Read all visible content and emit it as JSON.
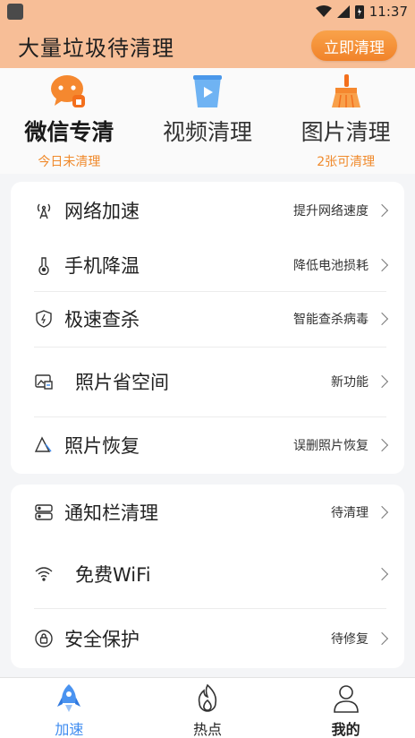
{
  "status_bar": {
    "time": "11:37"
  },
  "header": {
    "title": "大量垃圾待清理",
    "clean_button": "立即清理"
  },
  "quick_actions": [
    {
      "title": "微信专清",
      "subtitle": "今日未清理",
      "icon": "wechat-icon"
    },
    {
      "title": "视频清理",
      "subtitle": "",
      "icon": "video-icon"
    },
    {
      "title": "图片清理",
      "subtitle": "2张可清理",
      "icon": "broom-icon"
    }
  ],
  "group1": [
    {
      "title": "网络加速",
      "desc": "提升网络速度",
      "icon": "signal-tower-icon"
    },
    {
      "title": "手机降温",
      "desc": "降低电池损耗",
      "icon": "thermometer-icon"
    },
    {
      "title": "极速查杀",
      "desc": "智能查杀病毒",
      "icon": "shield-icon"
    },
    {
      "title": "照片省空间",
      "desc": "新功能",
      "icon": "photo-compress-icon"
    },
    {
      "title": "照片恢复",
      "desc": "误删照片恢复",
      "icon": "photo-restore-icon"
    }
  ],
  "group2": [
    {
      "title": "通知栏清理",
      "desc": "待清理",
      "icon": "notification-icon"
    },
    {
      "title": "免费WiFi",
      "desc": "",
      "icon": "wifi-icon"
    },
    {
      "title": "安全保护",
      "desc": "待修复",
      "icon": "lock-icon"
    }
  ],
  "tabs": [
    {
      "label": "加速",
      "icon": "rocket-icon",
      "active": true
    },
    {
      "label": "热点",
      "icon": "fire-icon",
      "active": false
    },
    {
      "label": "我的",
      "icon": "person-icon",
      "active": false
    }
  ],
  "colors": {
    "header_bg": "#f7be97",
    "accent_orange": "#f08a2c",
    "tab_active": "#3f8cf0"
  }
}
